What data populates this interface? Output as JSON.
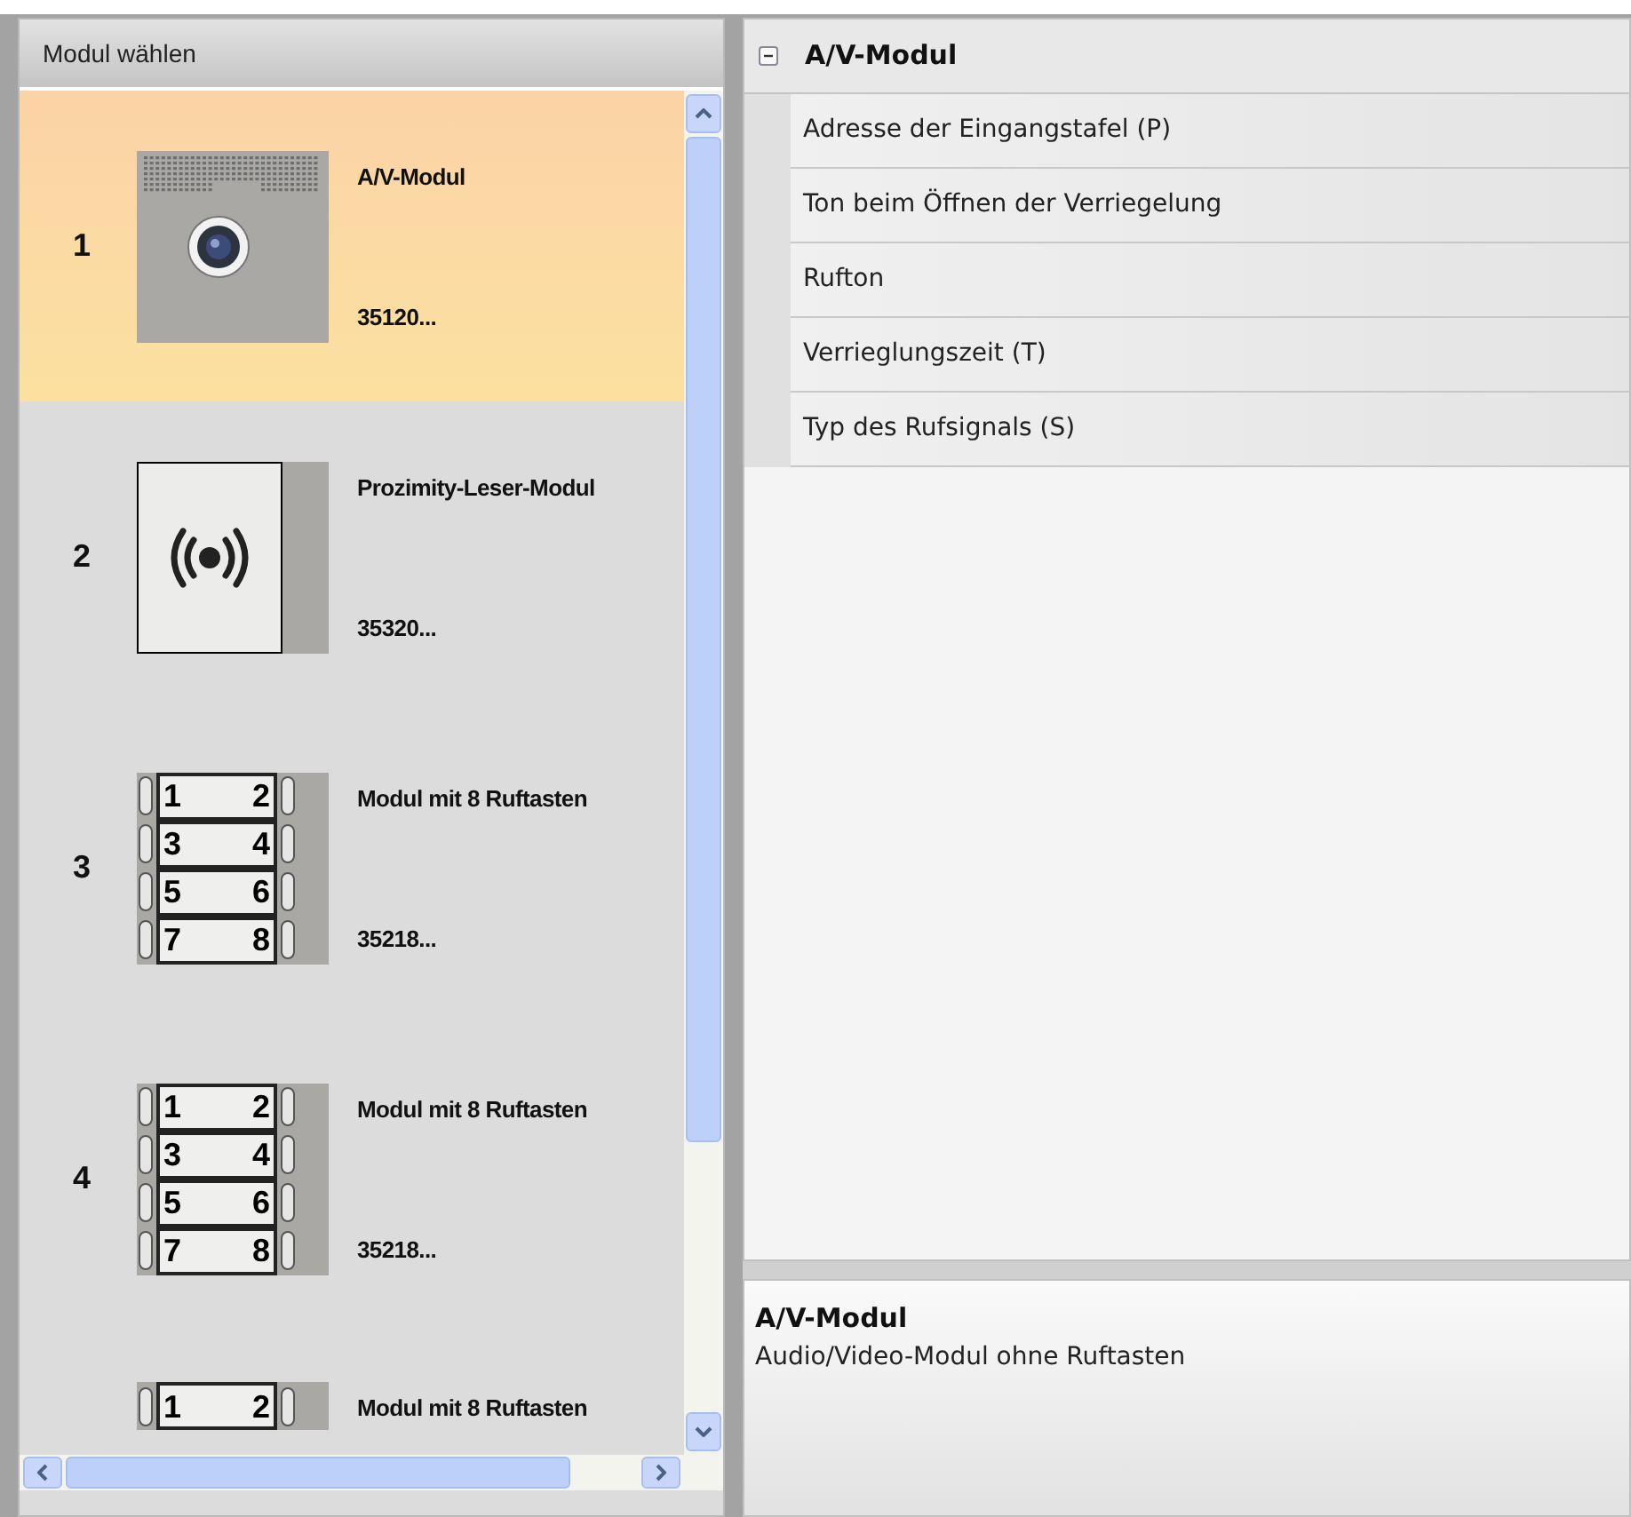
{
  "module_list": {
    "title": "Modul wählen",
    "items": [
      {
        "number": "1",
        "kind": "camera",
        "name": "A/V-Modul",
        "code": "35120...",
        "selected": true
      },
      {
        "number": "2",
        "kind": "proximity",
        "name": "Prozimity-Leser-Modul",
        "code": "35320...",
        "selected": false
      },
      {
        "number": "3",
        "kind": "keypad",
        "keys": [
          "1",
          "2",
          "3",
          "4",
          "5",
          "6",
          "7",
          "8"
        ],
        "name": "Modul mit 8 Ruftasten",
        "code": "35218...",
        "selected": false
      },
      {
        "number": "4",
        "kind": "keypad",
        "keys": [
          "1",
          "2",
          "3",
          "4",
          "5",
          "6",
          "7",
          "8"
        ],
        "name": "Modul mit 8 Ruftasten",
        "code": "35218...",
        "selected": false
      },
      {
        "kind": "keypad",
        "keys": [
          "1",
          "2"
        ],
        "name": "Modul mit 8 Ruftasten",
        "selected": false
      }
    ]
  },
  "properties": {
    "group": "A/V-Modul",
    "expanded": true,
    "rows": [
      "Adresse der Eingangstafel (P)",
      "Ton beim Öffnen der Verriegelung",
      "Rufton",
      "Verrieglungszeit (T)",
      "Typ des Rufsignals (S)"
    ]
  },
  "description": {
    "title": "A/V-Modul",
    "text": "Audio/Video-Modul ohne Ruftasten"
  }
}
